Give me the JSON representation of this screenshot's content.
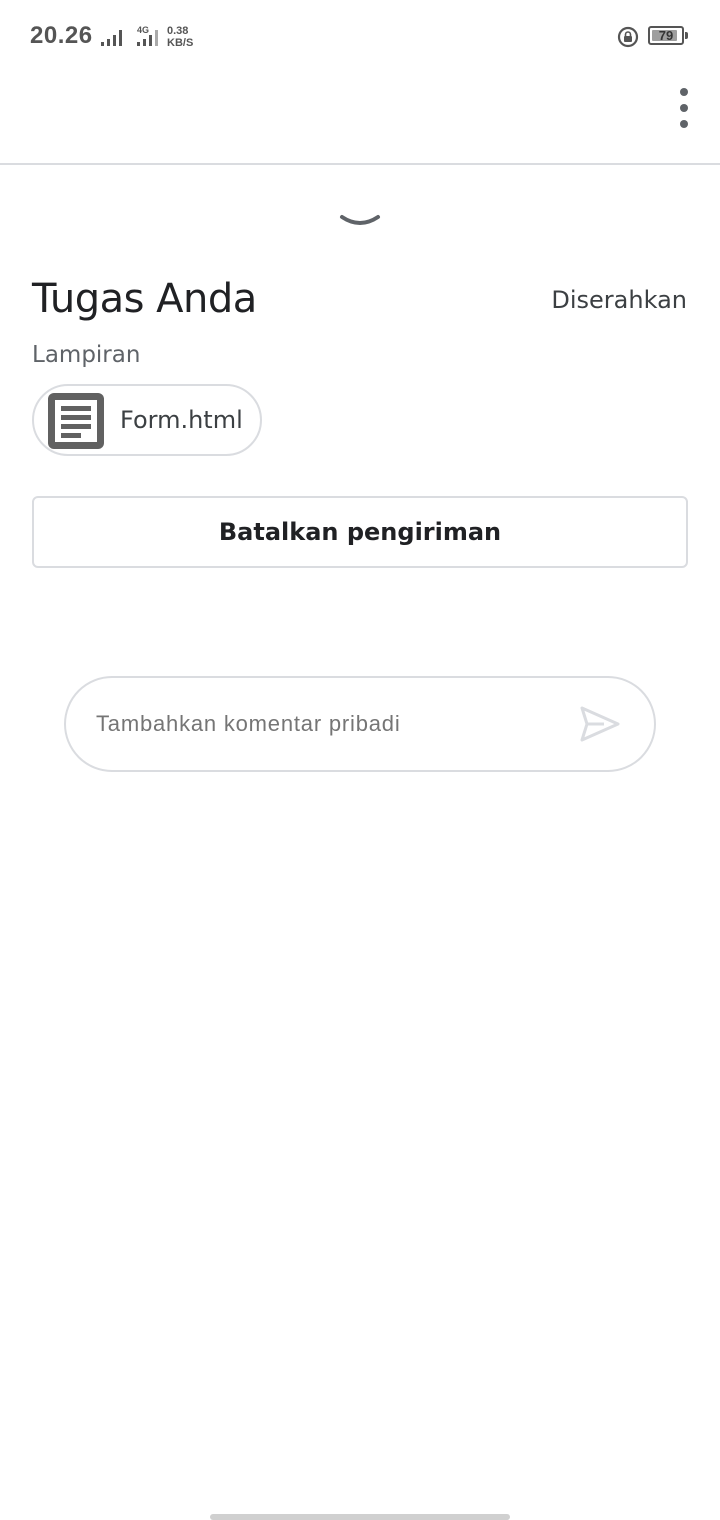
{
  "status_bar": {
    "time": "20.26",
    "network_type": "4G",
    "speed_value": "0.38",
    "speed_unit": "KB/S",
    "battery_level": "79",
    "icons": [
      "signal-icon",
      "signal-4g-icon",
      "rotation-lock-icon",
      "battery-icon"
    ]
  },
  "app_bar": {
    "more_icon": "more-vert-icon"
  },
  "sheet": {
    "collapse_icon": "chevron-down-icon",
    "title": "Tugas Anda",
    "status": "Diserahkan",
    "attachments_label": "Lampiran",
    "attachment": {
      "name": "Form.html",
      "icon": "document-icon"
    },
    "unsubmit_label": "Batalkan pengiriman",
    "comment": {
      "placeholder": "Tambahkan komentar pribadi",
      "value": "",
      "send_icon": "send-icon"
    }
  },
  "colors": {
    "text_primary": "#202124",
    "text_secondary": "#5f6368",
    "border": "#dadce0",
    "icon": "#616161"
  }
}
